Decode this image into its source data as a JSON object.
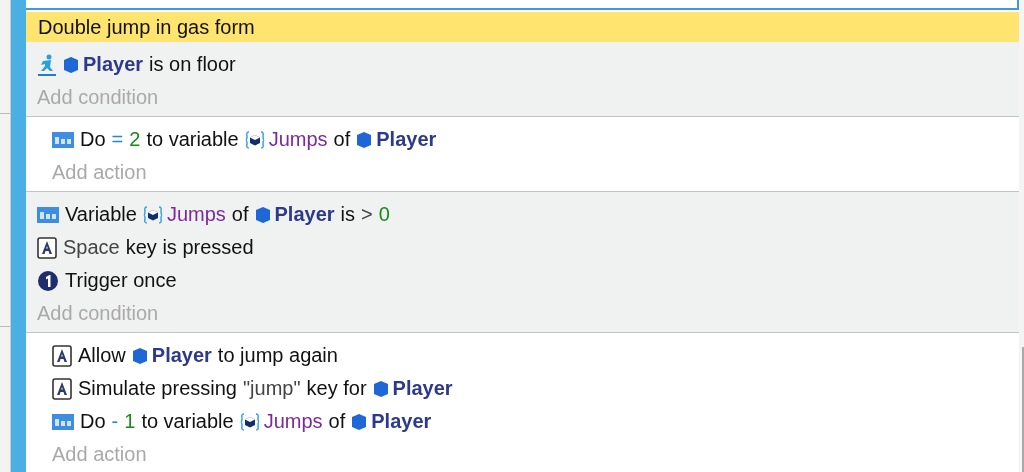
{
  "comment": {
    "text": "Double jump in gas form"
  },
  "events": [
    {
      "conditions": [
        {
          "kind": "platformer",
          "parts": [
            {
              "kind": "object",
              "text": "Player"
            },
            {
              "kind": "plain",
              "text": "is on floor"
            }
          ]
        }
      ],
      "add_condition": "Add condition",
      "actions": [
        {
          "kind": "variable",
          "parts": [
            {
              "kind": "plain",
              "text": "Do"
            },
            {
              "kind": "operator",
              "text": "="
            },
            {
              "kind": "number",
              "text": "2"
            },
            {
              "kind": "plain",
              "text": "to variable"
            },
            {
              "kind": "variable",
              "text": "Jumps"
            },
            {
              "kind": "plain",
              "text": "of"
            },
            {
              "kind": "object",
              "text": "Player"
            }
          ]
        }
      ],
      "add_action": "Add action"
    },
    {
      "conditions": [
        {
          "kind": "variable",
          "parts": [
            {
              "kind": "plain",
              "text": "Variable"
            },
            {
              "kind": "variable",
              "text": "Jumps"
            },
            {
              "kind": "plain",
              "text": "of"
            },
            {
              "kind": "object",
              "text": "Player"
            },
            {
              "kind": "plain",
              "text": "is"
            },
            {
              "kind": "param",
              "text": ">"
            },
            {
              "kind": "number",
              "text": "0"
            }
          ]
        },
        {
          "kind": "keyboard",
          "parts": [
            {
              "kind": "param",
              "text": "Space"
            },
            {
              "kind": "plain",
              "text": "key is pressed"
            }
          ]
        },
        {
          "kind": "trigger",
          "parts": [
            {
              "kind": "plain",
              "text": "Trigger once"
            }
          ]
        }
      ],
      "add_condition": "Add condition",
      "actions": [
        {
          "kind": "keyboard",
          "parts": [
            {
              "kind": "plain",
              "text": "Allow"
            },
            {
              "kind": "object",
              "text": "Player"
            },
            {
              "kind": "plain",
              "text": "to jump again"
            }
          ]
        },
        {
          "kind": "keyboard",
          "parts": [
            {
              "kind": "plain",
              "text": "Simulate pressing"
            },
            {
              "kind": "param",
              "text": "\"jump\""
            },
            {
              "kind": "plain",
              "text": "key for"
            },
            {
              "kind": "object",
              "text": "Player"
            }
          ]
        },
        {
          "kind": "variable",
          "parts": [
            {
              "kind": "plain",
              "text": "Do"
            },
            {
              "kind": "operator",
              "text": "-"
            },
            {
              "kind": "number",
              "text": "1"
            },
            {
              "kind": "plain",
              "text": "to variable"
            },
            {
              "kind": "variable",
              "text": "Jumps"
            },
            {
              "kind": "plain",
              "text": "of"
            },
            {
              "kind": "object",
              "text": "Player"
            }
          ]
        }
      ],
      "add_action": "Add action"
    }
  ]
}
